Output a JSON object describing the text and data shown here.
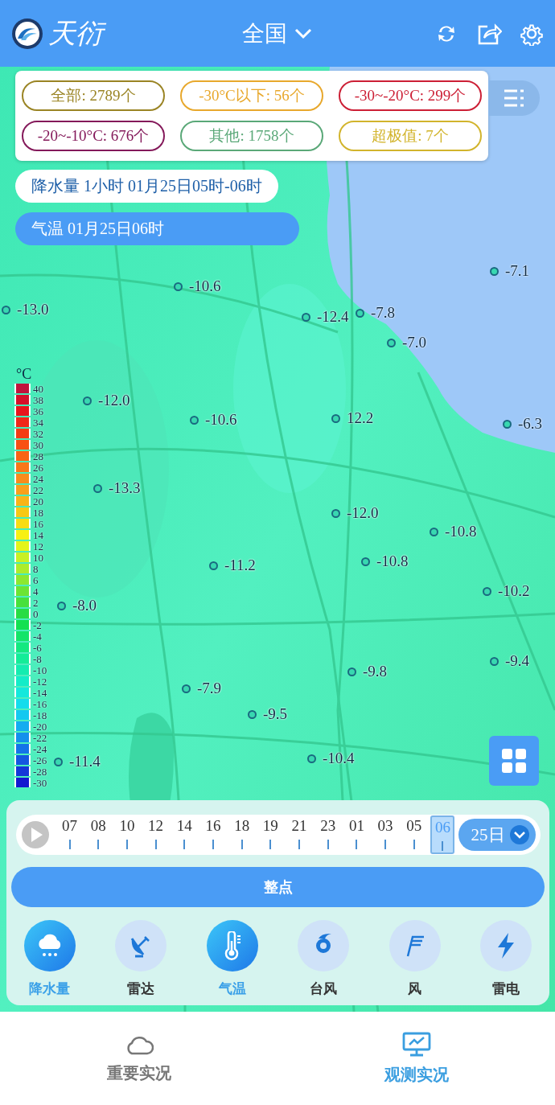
{
  "header": {
    "logo_text": "天衍",
    "region": "全国"
  },
  "filters": [
    {
      "label": "全部: 2789个",
      "color": "#9a8424"
    },
    {
      "label": "-30°C以下: 56个",
      "color": "#e8a82c"
    },
    {
      "label": "-30~-20°C: 299个",
      "color": "#cc1f35"
    },
    {
      "label": "-20~-10°C: 676个",
      "color": "#84195a"
    },
    {
      "label": "其他: 1758个",
      "color": "#5aa878"
    },
    {
      "label": "超极值: 7个",
      "color": "#d2b42c"
    }
  ],
  "layers": [
    {
      "label": "降水量 1小时 01月25日05时-06时",
      "selected": false
    },
    {
      "label": "气温 01月25日06时",
      "selected": true
    }
  ],
  "legend": {
    "unit": "°C",
    "items": [
      {
        "label": "40",
        "color": "#c0143c"
      },
      {
        "label": "38",
        "color": "#d6102a"
      },
      {
        "label": "36",
        "color": "#e8141c"
      },
      {
        "label": "34",
        "color": "#f02818"
      },
      {
        "label": "32",
        "color": "#f43c14"
      },
      {
        "label": "30",
        "color": "#f85014"
      },
      {
        "label": "28",
        "color": "#f86414"
      },
      {
        "label": "26",
        "color": "#f87818"
      },
      {
        "label": "24",
        "color": "#f88c1c"
      },
      {
        "label": "22",
        "color": "#f8a01c"
      },
      {
        "label": "20",
        "color": "#f8b418"
      },
      {
        "label": "18",
        "color": "#f8c814"
      },
      {
        "label": "16",
        "color": "#f8dc14"
      },
      {
        "label": "14",
        "color": "#f8f014"
      },
      {
        "label": "12",
        "color": "#e4f41c"
      },
      {
        "label": "10",
        "color": "#c8f024"
      },
      {
        "label": "8",
        "color": "#acec2c"
      },
      {
        "label": "6",
        "color": "#8ce830"
      },
      {
        "label": "4",
        "color": "#6ce434"
      },
      {
        "label": "2",
        "color": "#48e03c"
      },
      {
        "label": "0",
        "color": "#28dc44"
      },
      {
        "label": "-2",
        "color": "#14e050"
      },
      {
        "label": "-4",
        "color": "#14e468"
      },
      {
        "label": "-6",
        "color": "#14e880"
      },
      {
        "label": "-8",
        "color": "#14ec98"
      },
      {
        "label": "-10",
        "color": "#14ecb0"
      },
      {
        "label": "-12",
        "color": "#14ecc8"
      },
      {
        "label": "-14",
        "color": "#14e8dc"
      },
      {
        "label": "-16",
        "color": "#14dcec"
      },
      {
        "label": "-18",
        "color": "#14c8f0"
      },
      {
        "label": "-20",
        "color": "#14acf0"
      },
      {
        "label": "-22",
        "color": "#1490ec"
      },
      {
        "label": "-24",
        "color": "#1474e8"
      },
      {
        "label": "-26",
        "color": "#1458e0"
      },
      {
        "label": "-28",
        "color": "#1438d8"
      },
      {
        "label": "-30",
        "color": "#1418d0"
      }
    ]
  },
  "stations": [
    {
      "value": "-7.1"
    },
    {
      "value": "-10.6"
    },
    {
      "value": "-13.0"
    },
    {
      "value": "-12.4"
    },
    {
      "value": "-7.8"
    },
    {
      "value": "-7.0"
    },
    {
      "value": "-12.0"
    },
    {
      "value": "-10.6"
    },
    {
      "value": "12.2"
    },
    {
      "value": "-6.3"
    },
    {
      "value": "-13.3"
    },
    {
      "value": "-12.0"
    },
    {
      "value": "-10.8"
    },
    {
      "value": "-10.8"
    },
    {
      "value": "-11.2"
    },
    {
      "value": "-10.2"
    },
    {
      "value": "-8.0"
    },
    {
      "value": "-9.4"
    },
    {
      "value": "-9.8"
    },
    {
      "value": "-7.9"
    },
    {
      "value": "-9.5"
    },
    {
      "value": "-10.4"
    },
    {
      "value": "-11.4"
    }
  ],
  "timeline": {
    "hours": [
      {
        "label": "07",
        "selected": false
      },
      {
        "label": "08",
        "selected": false
      },
      {
        "label": "10",
        "selected": false
      },
      {
        "label": "12",
        "selected": false
      },
      {
        "label": "14",
        "selected": false
      },
      {
        "label": "16",
        "selected": false
      },
      {
        "label": "18",
        "selected": false
      },
      {
        "label": "19",
        "selected": false
      },
      {
        "label": "21",
        "selected": false
      },
      {
        "label": "23",
        "selected": false
      },
      {
        "label": "01",
        "selected": false
      },
      {
        "label": "03",
        "selected": false
      },
      {
        "label": "05",
        "selected": false
      },
      {
        "label": "06",
        "selected": true
      }
    ],
    "date": "25日",
    "mode_button": "整点"
  },
  "products": [
    {
      "kind": "rain",
      "label": "降水量",
      "on": true
    },
    {
      "kind": "radar",
      "label": "雷达",
      "on": false
    },
    {
      "kind": "temperature",
      "label": "气温",
      "on": true
    },
    {
      "kind": "typhoon",
      "label": "台风",
      "on": false
    },
    {
      "kind": "wind",
      "label": "风",
      "on": false
    },
    {
      "kind": "lightning",
      "label": "雷电",
      "on": false
    }
  ],
  "nav": [
    {
      "kind": "cloud",
      "label": "重要实况",
      "selected": false
    },
    {
      "kind": "monitor",
      "label": "观测实况",
      "selected": true
    }
  ]
}
